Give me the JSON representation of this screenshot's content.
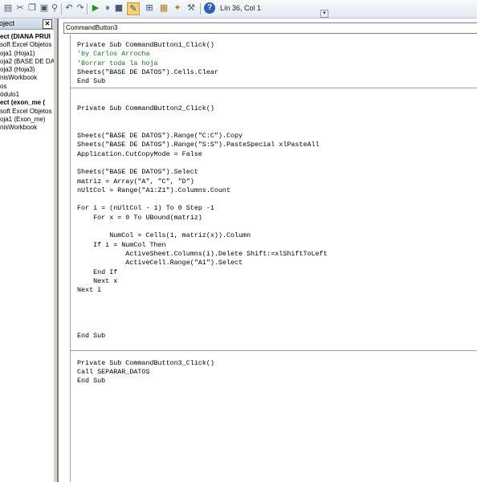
{
  "toolbar": {
    "status": "Lín 36, Col 1"
  },
  "project": {
    "title": "roject",
    "close": "✕",
    "items": [
      {
        "label": "ect (DIANA PRUI",
        "bold": true
      },
      {
        "label": "soft Excel Objetos",
        "bold": false
      },
      {
        "label": "oja1 (Hoja1)",
        "bold": false
      },
      {
        "label": "oja2 (BASE DE DAT",
        "bold": false
      },
      {
        "label": "oja3 (Hoja3)",
        "bold": false
      },
      {
        "label": "nisWorkbook",
        "bold": false
      },
      {
        "label": "os",
        "bold": false
      },
      {
        "label": "ódulo1",
        "bold": false
      },
      {
        "label": "ect (exon_me (",
        "bold": true
      },
      {
        "label": "soft Excel Objetos",
        "bold": false
      },
      {
        "label": "oja1 (Exon_me)",
        "bold": false
      },
      {
        "label": "nisWorkbook",
        "bold": false
      }
    ]
  },
  "editor": {
    "object": "CommandButton3",
    "lines": [
      "Private Sub CommandButton1_Click()",
      "'by Carlos Arrocha",
      "'Borrar toda la hoja",
      "Sheets(\"BASE DE DATOS\").Cells.Clear",
      "End Sub",
      "",
      "",
      "Private Sub CommandButton2_Click()",
      "",
      "",
      "Sheets(\"BASE DE DATOS\").Range(\"C:C\").Copy",
      "Sheets(\"BASE DE DATOS\").Range(\"S:S\").PasteSpecial xlPasteAll",
      "Application.CutCopyMode = False",
      "",
      "Sheets(\"BASE DE DATOS\").Select",
      "matriz = Array(\"A\", \"C\", \"D\")",
      "nUltCol = Range(\"A1:Z1\").Columns.Count",
      "",
      "For i = (nUltCol - 1) To 0 Step -1",
      "    For x = 0 To UBound(matriz)",
      "",
      "        NumCol = Cells(1, matriz(x)).Column",
      "    If i = NumCol Then",
      "            ActiveSheet.Columns(i).Delete Shift:=xlShiftToLeft",
      "            ActiveCell.Range(\"A1\").Select",
      "    End If",
      "    Next x",
      "Next i",
      "",
      "",
      "",
      "",
      "End Sub",
      "",
      "",
      "Private Sub CommandButton3_Click()",
      "Call SEPARAR_DATOS",
      "End Sub"
    ]
  }
}
